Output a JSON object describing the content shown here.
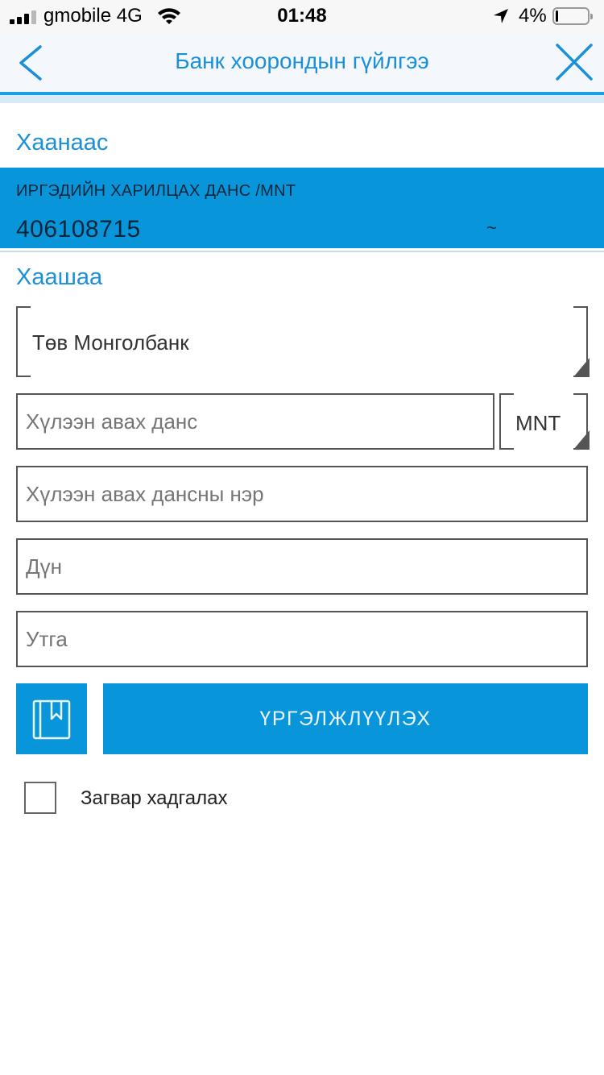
{
  "status_bar": {
    "carrier": "gmobile 4G",
    "time": "01:48",
    "battery_percent": "4%",
    "signal_bars": 4,
    "signal_bars_filled": 3,
    "battery_level": 0.04
  },
  "header": {
    "title": "Банк хоорондын гүйлгээ",
    "accent_color": "#1b9ee2"
  },
  "from": {
    "label": "Хаанаас",
    "account_type": "ИРГЭДИЙН ХАРИЛЦАХ ДАНС /MNT",
    "account_number": "406108715",
    "chevron": "~",
    "background_color": "#0995da"
  },
  "to": {
    "label": "Хаашаа",
    "bank": "Төв Монголбанк",
    "recipient_account_placeholder": "Хүлээн авах данс",
    "currency": "MNT",
    "recipient_name_placeholder": "Хүлээн авах дансны нэр",
    "amount_placeholder": "Дүн",
    "description_placeholder": "Утга"
  },
  "actions": {
    "continue_label": "ҮРГЭЛЖЛҮҮЛЭХ",
    "template_icon": "bookmark-book-icon",
    "save_template_label": "Загвар хадгалах",
    "save_template_checked": false
  }
}
